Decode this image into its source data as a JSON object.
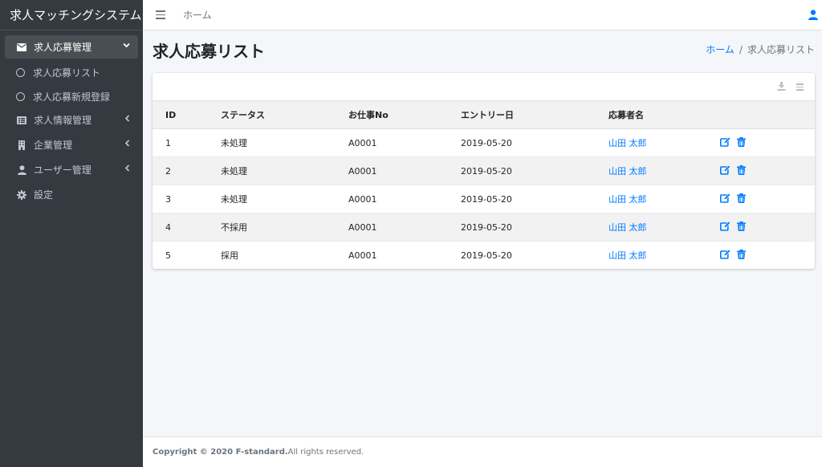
{
  "app": {
    "title": "求人マッチングシステム"
  },
  "sidebar": {
    "items": [
      {
        "label": "求人応募管理",
        "icon": "envelope-icon",
        "active": true,
        "caret": "down"
      },
      {
        "label": "求人応募リスト",
        "icon": "circle-icon",
        "sub": true
      },
      {
        "label": "求人応募新規登録",
        "icon": "circle-icon",
        "sub": true
      },
      {
        "label": "求人情報管理",
        "icon": "list-icon",
        "caret": "left"
      },
      {
        "label": "企業管理",
        "icon": "building-icon",
        "caret": "left"
      },
      {
        "label": "ユーザー管理",
        "icon": "user-icon",
        "caret": "left"
      },
      {
        "label": "設定",
        "icon": "gear-icon"
      }
    ]
  },
  "topbar": {
    "home": "ホーム"
  },
  "page": {
    "title": "求人応募リスト",
    "breadcrumb": {
      "home": "ホーム",
      "sep": "/",
      "current": "求人応募リスト"
    }
  },
  "table": {
    "headers": [
      "ID",
      "ステータス",
      "お仕事No",
      "エントリー日",
      "応募者名"
    ],
    "rows": [
      {
        "id": "1",
        "status": "未処理",
        "job_no": "A0001",
        "entry_date": "2019-05-20",
        "name": "山田 太郎"
      },
      {
        "id": "2",
        "status": "未処理",
        "job_no": "A0001",
        "entry_date": "2019-05-20",
        "name": "山田 太郎"
      },
      {
        "id": "3",
        "status": "未処理",
        "job_no": "A0001",
        "entry_date": "2019-05-20",
        "name": "山田 太郎"
      },
      {
        "id": "4",
        "status": "不採用",
        "job_no": "A0001",
        "entry_date": "2019-05-20",
        "name": "山田 太郎"
      },
      {
        "id": "5",
        "status": "採用",
        "job_no": "A0001",
        "entry_date": "2019-05-20",
        "name": "山田 太郎"
      }
    ]
  },
  "footer": {
    "copyright": "Copyright © 2020 F-standard.",
    "rights": " All rights reserved."
  },
  "colors": {
    "sidebar_bg": "#343a40",
    "link": "#007bff",
    "content_bg": "#f4f6f9"
  }
}
